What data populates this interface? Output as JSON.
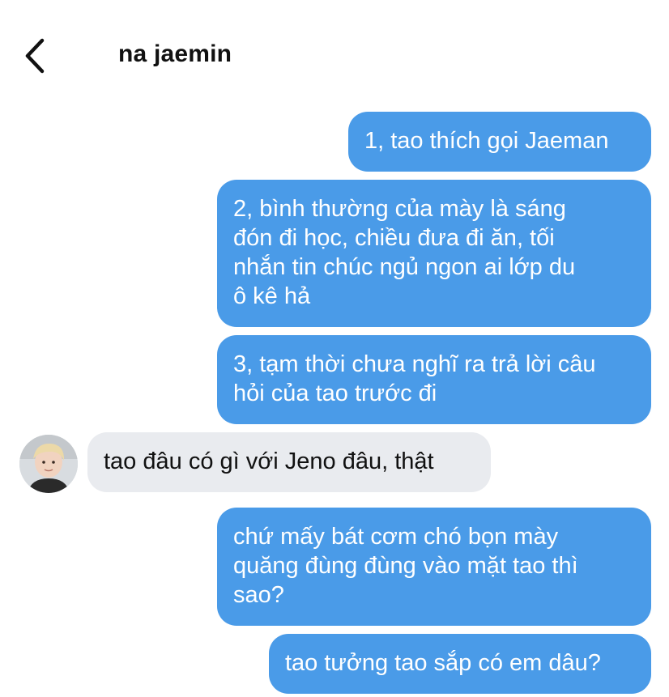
{
  "header": {
    "back_icon": "chevron-left-icon",
    "contact_name": "na jaemin"
  },
  "colors": {
    "outgoing_bubble": "#4a9be8",
    "incoming_bubble": "#e9ebef",
    "outgoing_text": "#ffffff",
    "incoming_text": "#111111"
  },
  "messages": [
    {
      "direction": "out",
      "text": "1, tao thích gọi Jaeman"
    },
    {
      "direction": "out",
      "text": "2, bình thường của mày là sáng\nđón đi học, chiều đưa đi ăn, tối\nnhắn tin chúc ngủ ngon ai lớp du\nô kê hả"
    },
    {
      "direction": "out",
      "text": "3, tạm thời chưa nghĩ ra trả lời câu\nhỏi của tao trước đi"
    },
    {
      "direction": "in",
      "text": "tao đâu có gì với Jeno đâu, thật"
    },
    {
      "direction": "out",
      "text": "chứ mấy bát cơm chó bọn mày\nquăng đùng đùng vào mặt tao thì\nsao?"
    },
    {
      "direction": "out",
      "text": "tao tưởng tao sắp có em dâu?"
    }
  ]
}
